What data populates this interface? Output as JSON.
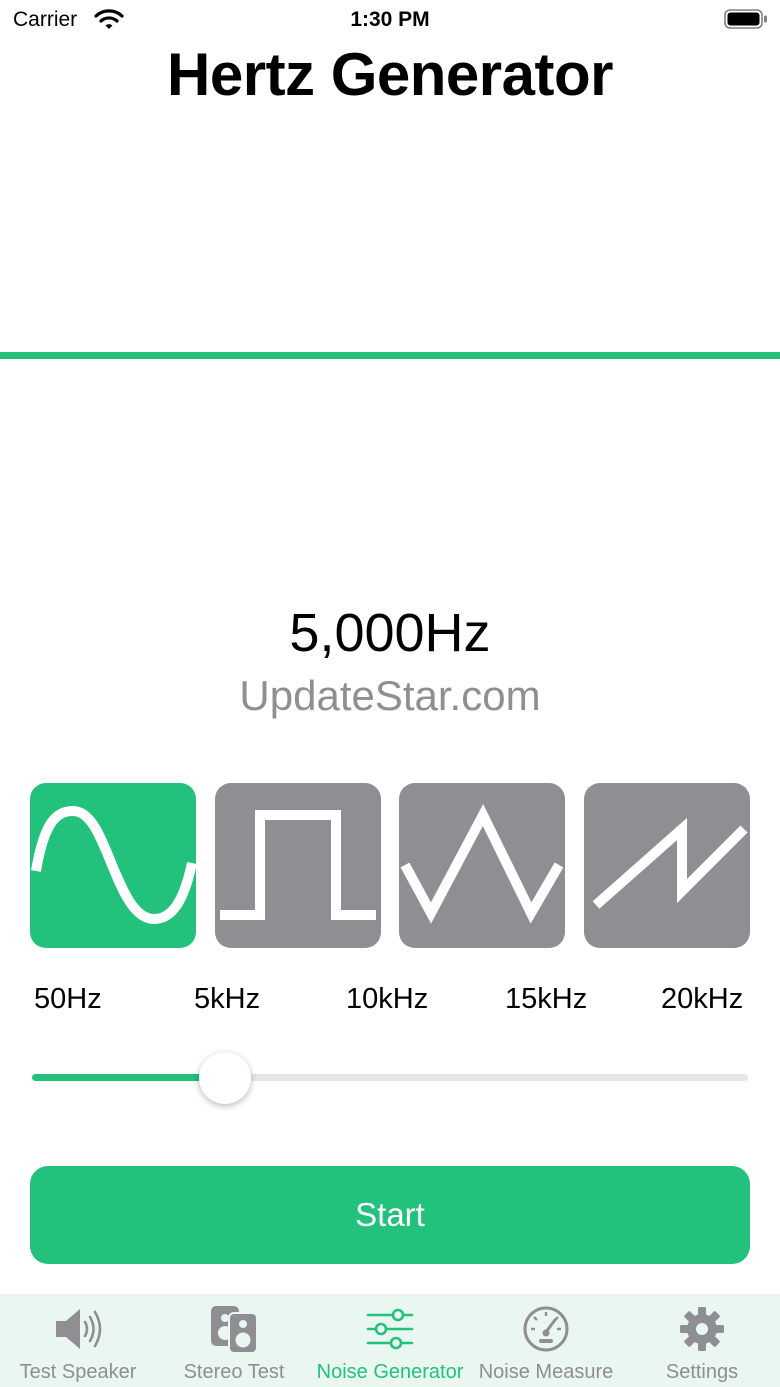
{
  "status_bar": {
    "carrier": "Carrier",
    "time": "1:30 PM"
  },
  "title": "Hertz Generator",
  "frequency_display": "5,000Hz",
  "watermark": "UpdateStar.com",
  "waveforms": [
    {
      "name": "sine",
      "icon": "sine-wave-icon",
      "selected": true
    },
    {
      "name": "square",
      "icon": "square-wave-icon",
      "selected": false
    },
    {
      "name": "triangle",
      "icon": "triangle-wave-icon",
      "selected": false
    },
    {
      "name": "sawtooth",
      "icon": "sawtooth-wave-icon",
      "selected": false
    }
  ],
  "ticks": [
    "50Hz",
    "5kHz",
    "10kHz",
    "15kHz",
    "20kHz"
  ],
  "slider": {
    "value_fraction": 0.27
  },
  "start_label": "Start",
  "tabs": [
    {
      "label": "Test Speaker",
      "icon": "speaker-icon",
      "active": false
    },
    {
      "label": "Stereo Test",
      "icon": "stereo-speaker-icon",
      "active": false
    },
    {
      "label": "Noise Generator",
      "icon": "sliders-icon",
      "active": true
    },
    {
      "label": "Noise Measure",
      "icon": "gauge-icon",
      "active": false
    },
    {
      "label": "Settings",
      "icon": "gear-icon",
      "active": false
    }
  ],
  "colors": {
    "accent": "#22c17c",
    "inactive": "#8e8e93",
    "tab_bar_bg": "#e9f7f0"
  }
}
